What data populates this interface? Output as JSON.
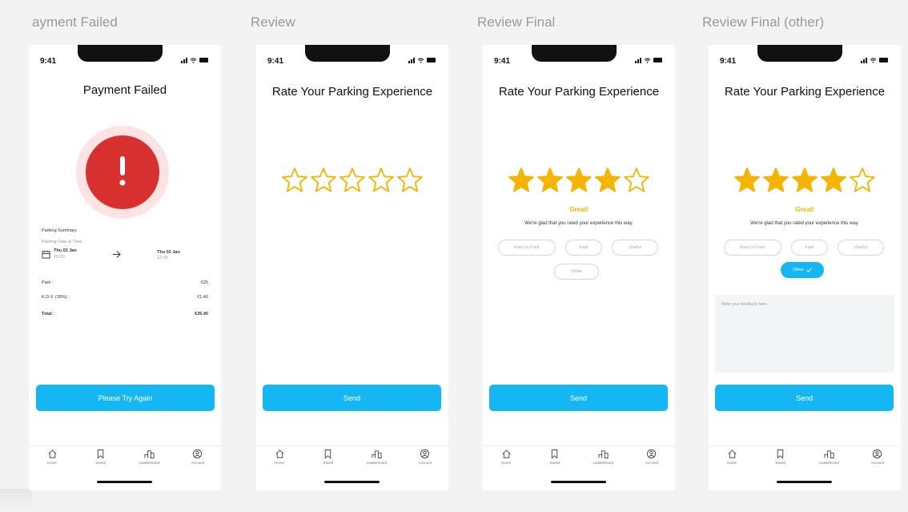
{
  "frames": [
    {
      "label": "ayment Failed"
    },
    {
      "label": "Review"
    },
    {
      "label": "Review Final"
    },
    {
      "label": "Review Final (other)"
    }
  ],
  "status": {
    "time": "9:41"
  },
  "payment": {
    "title": "Payment Failed",
    "summary_title": "Parking Summary",
    "date_time_label": "Parking Date & Time",
    "start_date": "Thu 02 Jan",
    "start_time": "10:00",
    "end_date": "Thu 02 Jan",
    "end_time": "12:00",
    "lines": [
      {
        "label": "Park :",
        "value": "€25"
      },
      {
        "label": "K.D.V. (18%) :",
        "value": "€1.40"
      },
      {
        "label": "Total :",
        "value": "€26.40"
      }
    ],
    "button": "Please Try Again"
  },
  "review": {
    "title": "Rate Your Parking Experience",
    "rating_empty": 0,
    "rating_final": 4,
    "rating_max": 5,
    "great": "Great!",
    "glad": "We're glad that you rated your experience this way.",
    "chips": [
      "Easy to Park",
      "Fast",
      "Useful",
      "Other"
    ],
    "feedback_placeholder": "Write your feedback here...",
    "send": "Send"
  },
  "tabs": [
    {
      "label": "Home",
      "icon": "home-icon"
    },
    {
      "label": "Saved",
      "icon": "bookmark-icon"
    },
    {
      "label": "Leaderboard",
      "icon": "leaderboard-icon"
    },
    {
      "label": "Account",
      "icon": "account-icon"
    }
  ],
  "colors": {
    "accent": "#14b6f4",
    "star": "#f5b400",
    "error": "#d8302f",
    "error_bg": "#fde3e3"
  }
}
